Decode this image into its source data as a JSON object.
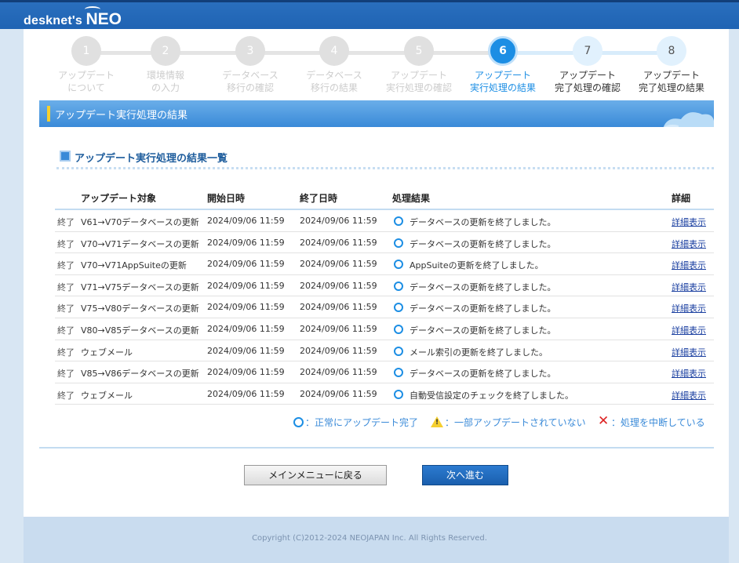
{
  "header": {
    "logo_small": "desknet's",
    "logo_big": "NEO"
  },
  "steps": [
    {
      "number": "1",
      "label_line1": "アップデート",
      "label_line2": "について",
      "state": "done"
    },
    {
      "number": "2",
      "label_line1": "環境情報",
      "label_line2": "の入力",
      "state": "done"
    },
    {
      "number": "3",
      "label_line1": "データベース",
      "label_line2": "移行の確認",
      "state": "done"
    },
    {
      "number": "4",
      "label_line1": "データベース",
      "label_line2": "移行の結果",
      "state": "done"
    },
    {
      "number": "5",
      "label_line1": "アップデート",
      "label_line2": "実行処理の確認",
      "state": "done"
    },
    {
      "number": "6",
      "label_line1": "アップデート",
      "label_line2": "実行処理の結果",
      "state": "current"
    },
    {
      "number": "7",
      "label_line1": "アップデート",
      "label_line2": "完了処理の確認",
      "state": "future"
    },
    {
      "number": "8",
      "label_line1": "アップデート",
      "label_line2": "完了処理の結果",
      "state": "future"
    }
  ],
  "page_title": "アップデート実行処理の結果",
  "section_title": "アップデート実行処理の結果一覧",
  "table": {
    "headers": {
      "target": "アップデート対象",
      "start": "開始日時",
      "end": "終了日時",
      "result": "処理結果",
      "detail": "詳細"
    },
    "rows": [
      {
        "status": "終了",
        "target": "V61→V70データベースの更新",
        "start": "2024/09/06 11:59",
        "end": "2024/09/06 11:59",
        "result": "データベースの更新を終了しました。",
        "detail": "詳細表示"
      },
      {
        "status": "終了",
        "target": "V70→V71データベースの更新",
        "start": "2024/09/06 11:59",
        "end": "2024/09/06 11:59",
        "result": "データベースの更新を終了しました。",
        "detail": "詳細表示"
      },
      {
        "status": "終了",
        "target": "V70→V71AppSuiteの更新",
        "start": "2024/09/06 11:59",
        "end": "2024/09/06 11:59",
        "result": "AppSuiteの更新を終了しました。",
        "detail": "詳細表示"
      },
      {
        "status": "終了",
        "target": "V71→V75データベースの更新",
        "start": "2024/09/06 11:59",
        "end": "2024/09/06 11:59",
        "result": "データベースの更新を終了しました。",
        "detail": "詳細表示"
      },
      {
        "status": "終了",
        "target": "V75→V80データベースの更新",
        "start": "2024/09/06 11:59",
        "end": "2024/09/06 11:59",
        "result": "データベースの更新を終了しました。",
        "detail": "詳細表示"
      },
      {
        "status": "終了",
        "target": "V80→V85データベースの更新",
        "start": "2024/09/06 11:59",
        "end": "2024/09/06 11:59",
        "result": "データベースの更新を終了しました。",
        "detail": "詳細表示"
      },
      {
        "status": "終了",
        "target": "ウェブメール",
        "start": "2024/09/06 11:59",
        "end": "2024/09/06 11:59",
        "result": "メール索引の更新を終了しました。",
        "detail": "詳細表示"
      },
      {
        "status": "終了",
        "target": "V85→V86データベースの更新",
        "start": "2024/09/06 11:59",
        "end": "2024/09/06 11:59",
        "result": "データベースの更新を終了しました。",
        "detail": "詳細表示"
      },
      {
        "status": "終了",
        "target": "ウェブメール",
        "start": "2024/09/06 11:59",
        "end": "2024/09/06 11:59",
        "result": "自動受信設定のチェックを終了しました。",
        "detail": "詳細表示"
      }
    ]
  },
  "legend": {
    "ok": "：正常にアップデート完了",
    "warn": "：一部アップデートされていない",
    "error": "：処理を中断している"
  },
  "buttons": {
    "back": "メインメニューに戻る",
    "next": "次へ進む"
  },
  "footer": {
    "copyright": "Copyright (C)2012-2024 NEOJAPAN Inc. All Rights Reserved."
  },
  "colors": {
    "brand": "#1f63b3",
    "accent": "#1c8ee4",
    "highlight": "#f5cf2f",
    "error": "#dd2222"
  }
}
